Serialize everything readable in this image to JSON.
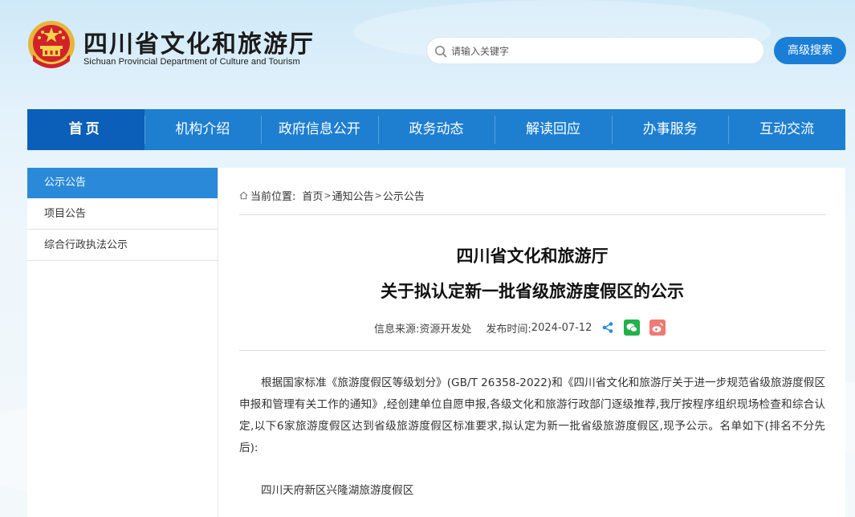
{
  "header": {
    "title_cn": "四川省文化和旅游厅",
    "title_en": "Sichuan Provincial Department of Culture and Tourism",
    "search_placeholder": "请输入关键字",
    "advanced_search_label": "高级搜索"
  },
  "nav": {
    "items": [
      {
        "label": "首页",
        "active": true
      },
      {
        "label": "机构介绍"
      },
      {
        "label": "政府信息公开"
      },
      {
        "label": "政务动态"
      },
      {
        "label": "解读回应"
      },
      {
        "label": "办事服务"
      },
      {
        "label": "互动交流"
      }
    ]
  },
  "sidebar": {
    "items": [
      {
        "label": "公示公告",
        "active": true
      },
      {
        "label": "项目公告"
      },
      {
        "label": "综合行政执法公示"
      }
    ]
  },
  "breadcrumb": {
    "prefix": "当前位置:",
    "items": [
      "首页",
      "通知公告",
      "公示公告"
    ],
    "separator": ">"
  },
  "article": {
    "title_line1": "四川省文化和旅游厅",
    "title_line2": "关于拟认定新一批省级旅游度假区的公示",
    "source_label": "信息来源:",
    "source_value": "资源开发处",
    "date_label": "发布时间:",
    "date_value": "2024-07-12",
    "paragraph": "根据国家标准《旅游度假区等级划分》(GB/T 26358-2022)和《四川省文化和旅游厅关于进一步规范省级旅游度假区申报和管理有关工作的通知》,经创建单位自愿申报,各级文化和旅游行政部门逐级推荐,我厅按程序组织现场检查和综合认定,以下6家旅游度假区达到省级旅游度假区标准要求,拟认定为新一批省级旅游度假区,现予公示。名单如下(排名不分先后):",
    "list": [
      "四川天府新区兴隆湖旅游度假区"
    ]
  },
  "colors": {
    "nav_bg": "#1e7fd1",
    "nav_active": "#0b5fb8",
    "sidebar_active": "#2a8ad9",
    "wechat": "#22b14c",
    "weibo": "#ee7a74"
  },
  "icons": [
    "national-emblem-icon",
    "search-icon",
    "home-icon",
    "share-icon",
    "wechat-icon",
    "weibo-icon"
  ]
}
